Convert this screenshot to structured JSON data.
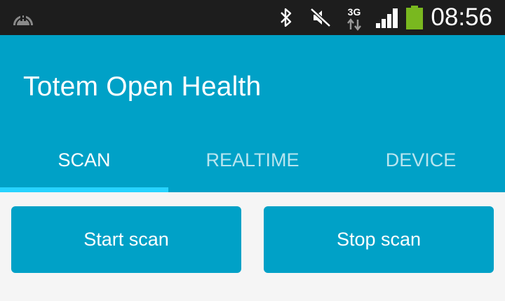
{
  "status_bar": {
    "time": "08:56",
    "network_type": "3G",
    "icons": [
      "notification-icon",
      "bluetooth-icon",
      "mute-icon",
      "data-3g-icon",
      "signal-icon",
      "battery-icon"
    ]
  },
  "app_bar": {
    "title": "Totem Open Health"
  },
  "tabs": [
    {
      "label": "SCAN",
      "active": true
    },
    {
      "label": "REALTIME",
      "active": false
    },
    {
      "label": "DEVICE",
      "active": false
    }
  ],
  "actions": {
    "start_label": "Start scan",
    "stop_label": "Stop scan"
  },
  "colors": {
    "primary": "#00a1c7",
    "tab_indicator": "#27d3ff",
    "status_bar": "#1d1d1d",
    "battery": "#79b81f",
    "background": "#f5f5f5"
  }
}
